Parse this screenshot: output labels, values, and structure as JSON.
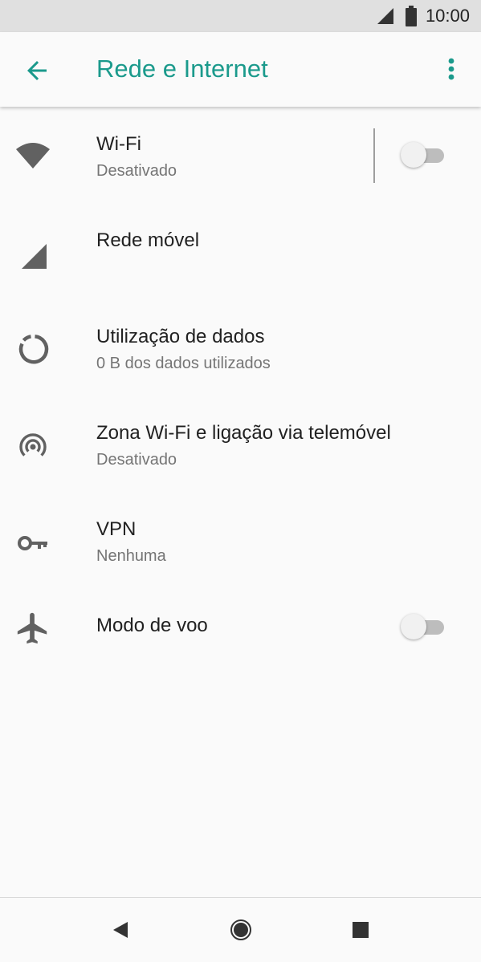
{
  "status_bar": {
    "time": "10:00",
    "icons": [
      "signal-icon",
      "battery-icon"
    ]
  },
  "app_bar": {
    "title": "Rede e Internet",
    "back_icon": "arrow-back-icon",
    "more_icon": "more-vert-icon",
    "accent_color": "#1b9a8c"
  },
  "settings": {
    "wifi": {
      "title": "Wi-Fi",
      "summary": "Desativado",
      "icon": "wifi-icon",
      "toggle_on": false
    },
    "mobile_network": {
      "title": "Rede móvel",
      "icon": "cell-signal-icon"
    },
    "data_usage": {
      "title": "Utilização de dados",
      "summary": "0 B dos dados utilizados",
      "icon": "data-usage-icon"
    },
    "hotspot": {
      "title": "Zona Wi-Fi e ligação via telemóvel",
      "summary": "Desativado",
      "icon": "hotspot-icon"
    },
    "vpn": {
      "title": "VPN",
      "summary": "Nenhuma",
      "icon": "vpn-key-icon"
    },
    "airplane": {
      "title": "Modo de voo",
      "icon": "airplane-icon",
      "toggle_on": false
    }
  },
  "nav_bar": {
    "icons": [
      "nav-back-icon",
      "nav-home-icon",
      "nav-recents-icon"
    ]
  }
}
